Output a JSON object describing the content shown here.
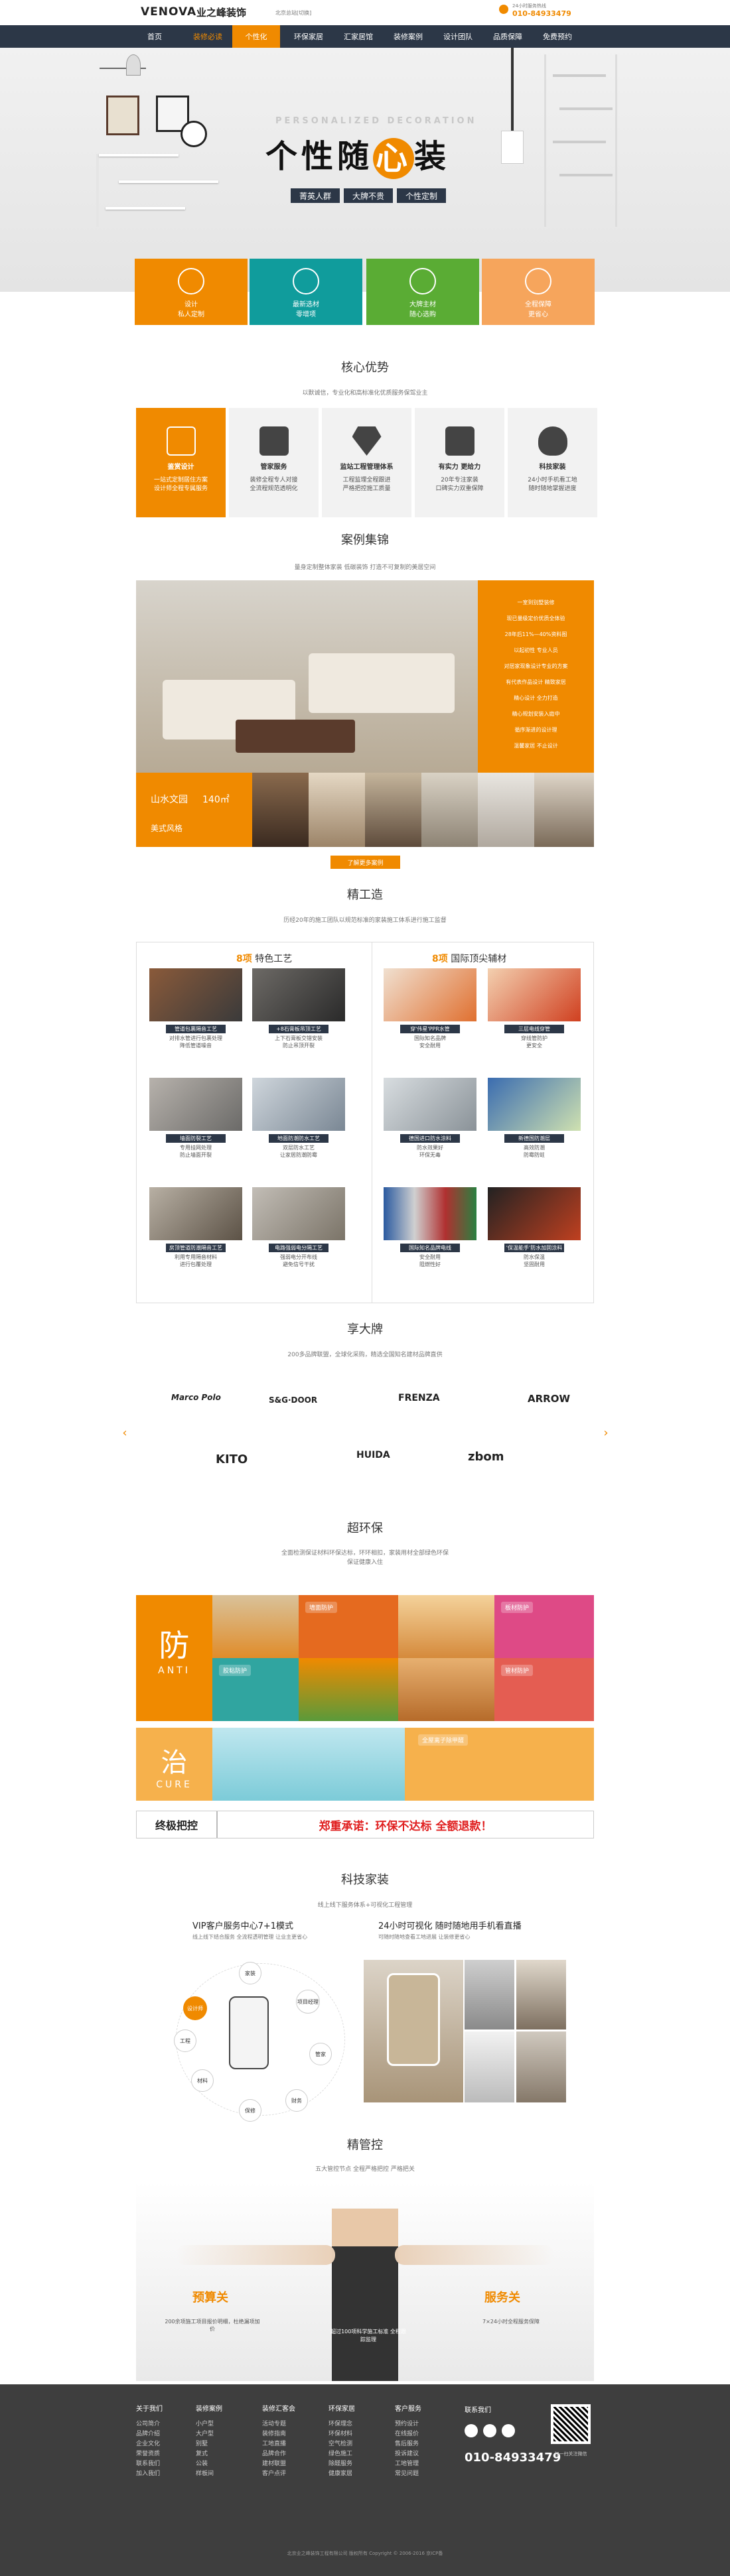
{
  "header": {
    "brand": "VENOVA",
    "brand_cn": "业之峰装饰",
    "city": "北京总站[切换]",
    "hotline_label": "24小时服务热线",
    "hotline": "010-84933479",
    "nav": [
      "首页",
      "装修必读",
      "个性化",
      "环保家居",
      "汇家居馆",
      "装修案例",
      "设计团队",
      "品质保障",
      "免费预约"
    ]
  },
  "banner": {
    "eyebrow": "PERSONALIZED DECORATION",
    "title_a": "个性随",
    "title_b": "心",
    "title_c": "装",
    "tags": [
      "菁英人群",
      "大牌不贵",
      "个性定制"
    ],
    "features": [
      {
        "label": "设计\n私人定制",
        "color": "#f08a00"
      },
      {
        "label": "最新选材\n零增项",
        "color": "#109c9c"
      },
      {
        "label": "大牌主材\n随心选购",
        "color": "#5aac34"
      },
      {
        "label": "全程保障\n更省心",
        "color": "#f6a55c"
      }
    ]
  },
  "advantages": {
    "title": "核心优势",
    "subtitle": "以默诚信，专业化和高标准化优质服务保驾业主",
    "items": [
      {
        "t": "鉴赏设计",
        "d": "一站式定制居住方案\n设计师全程专属服务"
      },
      {
        "t": "管家服务",
        "d": "装修全程专人对接\n全流程规范透明化"
      },
      {
        "t": "监站工程管理体系",
        "d": "工程监理全程跟进\n严格把控施工质量"
      },
      {
        "t": "有实力 更给力",
        "d": "20年专注家装\n口碑实力双重保障"
      },
      {
        "t": "科技家装",
        "d": "24小时手机看工地\n随时随地掌握进度"
      }
    ]
  },
  "cases": {
    "title": "案例集锦",
    "subtitle": "量身定制整体家装 低碳装饰 打造不可复制的美居空间",
    "list": [
      "一室到别墅装修",
      "现已量级定价优质全体验",
      "28年后11%—40%资料图",
      "以起初性 专业人员",
      "对居家现象设计专业的方案",
      "有代表作品设计 精致家居",
      "精心设计 全力打造",
      "精心规划安装入庭中",
      "循序渐进的设计理",
      "温馨家居 不止设计"
    ],
    "case_name": "山水文园",
    "case_area": "140㎡",
    "case_style": "美式风格",
    "more": "了解更多案例"
  },
  "craft": {
    "title": "精工造",
    "subtitle": "历经20年的施工团队以规范标准的家装施工体系进行施工监督",
    "left_head_num": "8项",
    "left_head": "特色工艺",
    "right_head_num": "8项",
    "right_head": "国际顶尖辅材",
    "left": [
      {
        "t": "管道包裹隔音工艺",
        "d": "对排水管进行包裹处理\n降低管道噪音"
      },
      {
        "t": "+8石膏板吊顶工艺",
        "d": "上下石膏板交错安装\n防止吊顶开裂"
      },
      {
        "t": "墙面防裂工艺",
        "d": "专用挂网处理\n防止墙面开裂"
      },
      {
        "t": "地面防潮防水工艺",
        "d": "双层防水工艺\n让家居防潮防霉"
      },
      {
        "t": "房顶管道防潮隔音工艺",
        "d": "利用专用隔音材料\n进行包覆处理"
      },
      {
        "t": "电路强弱电分隔工艺",
        "d": "强弱电分开布线\n避免信号干扰"
      }
    ],
    "right": [
      {
        "t": "穿'伟星'PPR水管",
        "d": "国际知名品牌\n安全耐用"
      },
      {
        "t": "三层电线穿管",
        "d": "穿线管防护\n更安全"
      },
      {
        "t": "德国进口防水涂料",
        "d": "防水效果好\n环保无毒"
      },
      {
        "t": "新德国防潮层",
        "d": "高效防潮\n防霉防蛀"
      },
      {
        "t": "国际知名品牌电线",
        "d": "安全耐用\n阻燃性好"
      },
      {
        "t": "'保温能手'防水加固涂料",
        "d": "防水保温\n坚固耐用"
      }
    ]
  },
  "brands": {
    "title": "享大牌",
    "subtitle": "200多品牌联盟，全球化采购，精选全国知名建材品牌直供",
    "items": [
      "Marco Polo",
      "S&G·DOOR",
      "FRENZA",
      "ARROW",
      "KITO",
      "HUIDA",
      "zbom"
    ]
  },
  "eco": {
    "title": "超环保",
    "subtitle": "全面检测保证材料环保达标，环环相扣，家装用材全部绿色环保保证健康入住",
    "prevent_cn": "防",
    "prevent_en": "ANTI",
    "cure_cn": "治",
    "cure_en": "CURE",
    "tags": [
      "墙面防护",
      "板材防护",
      "胶粘防护",
      "管材防护",
      "全屋离子除甲醛"
    ],
    "ultimate": "终极把控",
    "promise": "郑重承诺：环保不达标 全额退款！"
  },
  "tech": {
    "title": "科技家装",
    "subtitle": "线上线下服务体系+可视化工程管理",
    "left_title": "VIP客户服务中心7+1模式",
    "left_desc": "线上线下结合服务 全流程透明管理 让业主更省心",
    "right_title": "24小时可视化 随时随地用手机看直播",
    "right_desc": "可随时随地查看工地进展 让装修更省心",
    "bubbles": [
      "设计师",
      "家装",
      "项目经理",
      "管家",
      "财务",
      "保修",
      "材料",
      "工程"
    ]
  },
  "control": {
    "title": "精管控",
    "subtitle": "五大管控节点 全程严格把控 严格把关",
    "left_title": "预算关",
    "left_desc": "200余项施工项目报价明细，杜绝漏项加价",
    "center_desc": "超过100项科学施工标准 全程跟踪监理",
    "right_title": "服务关",
    "right_desc": "7×24小时全程服务保障"
  },
  "footer": {
    "cols": [
      {
        "h": "关于我们",
        "items": [
          "公司简介",
          "品牌介绍",
          "企业文化",
          "荣誉资质",
          "联系我们",
          "加入我们"
        ]
      },
      {
        "h": "装修案例",
        "items": [
          "小户型",
          "大户型",
          "别墅",
          "复式",
          "公装",
          "样板间"
        ]
      },
      {
        "h": "装修汇客会",
        "items": [
          "活动专题",
          "装修指南",
          "工地直播",
          "品牌合作",
          "建材联盟",
          "客户点评"
        ]
      },
      {
        "h": "环保家居",
        "items": [
          "环保理念",
          "环保材料",
          "空气检测",
          "绿色施工",
          "除醛服务",
          "健康家居"
        ]
      },
      {
        "h": "客户服务",
        "items": [
          "预约设计",
          "在线报价",
          "售后服务",
          "投诉建议",
          "工地管理",
          "常见问题"
        ]
      }
    ],
    "contact_label": "联系我们",
    "hotline": "010-84933479",
    "qr_label": "扫一扫关注微信",
    "copyright": "北京业之峰装饰工程有限公司 版权所有 Copyright © 2006-2016 京ICP备"
  },
  "colors": {
    "orange": "#f08a00",
    "navy": "#2c3747",
    "teal": "#109c9c",
    "green": "#5aac34"
  }
}
